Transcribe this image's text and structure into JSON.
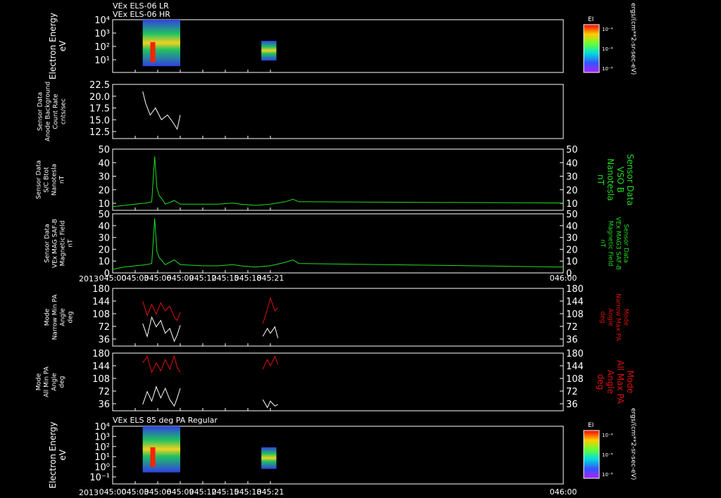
{
  "header": {
    "line1": "VEx ELS-06 LR",
    "line2": "VEx ELS-06 HR",
    "panel7_title": "VEx ELS 85 deg PA Regular",
    "year": "2013"
  },
  "colorbar": {
    "label": "EI",
    "ticks": [
      "10⁻⁴",
      "10⁻⁶",
      "10⁻⁸"
    ],
    "units": "ergs/(cm**2-sr-sec-eV)"
  },
  "colors": {
    "white": "#ffffff",
    "green": "#22dd22",
    "red": "#dd1111",
    "axis": "#ffffff"
  },
  "time_axis": {
    "start": "045:00",
    "end": "046:00",
    "ticks": [
      "045:00",
      "045:03",
      "045:06",
      "045:09",
      "045:12",
      "045:15",
      "045:18",
      "045:21",
      "046:00"
    ]
  },
  "chart_data": [
    {
      "type": "heatmap",
      "name": "panel1",
      "ylabel": [
        "Electron Energy",
        "eV"
      ],
      "yscale": "log",
      "yticks": [
        "10⁴",
        "10³",
        "10²",
        "10¹"
      ],
      "ylim": [
        1,
        10000
      ],
      "blocks": [
        {
          "x_start": "045:04",
          "x_end": "045:09",
          "e_min": 3,
          "e_max": 10000
        },
        {
          "x_start": "045:19.8",
          "x_end": "045:21.8",
          "e_min": 8,
          "e_max": 250
        }
      ],
      "feature": {
        "x": "045:05.3",
        "e_min": 6,
        "e_max": 200
      }
    },
    {
      "type": "line",
      "name": "panel2",
      "ylabel": [
        "Sensor Data",
        "Anode Background",
        "Count Rate",
        "cnts/sec"
      ],
      "ylim": [
        11,
        22.5
      ],
      "yticks": [
        "22.5",
        "20.0",
        "17.5",
        "15.0",
        "12.5"
      ],
      "series": [
        {
          "color": "white",
          "points": [
            [
              "045:04",
              21
            ],
            [
              "045:04.4",
              18.5
            ],
            [
              "045:05",
              16
            ],
            [
              "045:05.7",
              17.5
            ],
            [
              "045:06.5",
              15
            ],
            [
              "045:07.3",
              16
            ],
            [
              "045:08",
              14.5
            ],
            [
              "045:08.6",
              13
            ],
            [
              "045:09",
              16
            ]
          ]
        }
      ]
    },
    {
      "type": "line",
      "name": "panel3",
      "ylabel": [
        "Sensor Data",
        "S/C Btot",
        "Nanotesla",
        "nT"
      ],
      "ylabel_right": [
        "Sensor Data",
        "VSO B",
        "Nanotesla",
        "nT"
      ],
      "ylim": [
        0,
        50
      ],
      "yticks": [
        "50",
        "40",
        "30",
        "20",
        "10"
      ],
      "yticks_right": [
        "50",
        "40",
        "30",
        "20",
        "10"
      ],
      "series": [
        {
          "color": "green",
          "points": [
            [
              "045:00",
              3
            ],
            [
              "045:01.5",
              4
            ],
            [
              "045:03",
              5
            ],
            [
              "045:04.5",
              6
            ],
            [
              "045:05.2",
              7
            ],
            [
              "045:05.6",
              44
            ],
            [
              "045:05.9",
              18
            ],
            [
              "045:06.2",
              12
            ],
            [
              "045:06.6",
              9
            ],
            [
              "045:07",
              5
            ],
            [
              "045:08.2",
              8
            ],
            [
              "045:09",
              5
            ],
            [
              "045:12",
              5
            ],
            [
              "045:14",
              5
            ],
            [
              "045:16",
              6
            ],
            [
              "045:17",
              5
            ],
            [
              "045:19",
              4
            ],
            [
              "045:21",
              5
            ],
            [
              "045:23",
              7
            ],
            [
              "045:24",
              9
            ],
            [
              "045:24.8",
              7
            ],
            [
              "046:00",
              6
            ]
          ]
        }
      ]
    },
    {
      "type": "line",
      "name": "panel4",
      "ylabel": [
        "Sensor Data",
        "VEx MAG SAF-B",
        "Magnetic Field",
        "nT"
      ],
      "ylabel_right": [
        "Sensor Data",
        "VEx MAG3 SAF-B",
        "Magnetic Field",
        "nT"
      ],
      "ylim": [
        0,
        50
      ],
      "yticks": [
        "50",
        "40",
        "30",
        "20",
        "10",
        "0"
      ],
      "yticks_right": [
        "50",
        "40",
        "30",
        "20",
        "10",
        "0"
      ],
      "series": [
        {
          "color": "green",
          "points": [
            [
              "045:00",
              3
            ],
            [
              "045:01.5",
              5
            ],
            [
              "045:03",
              6
            ],
            [
              "045:04.5",
              7
            ],
            [
              "045:05.2",
              8
            ],
            [
              "045:05.6",
              46
            ],
            [
              "045:05.9",
              18
            ],
            [
              "045:06.2",
              13
            ],
            [
              "045:06.6",
              10
            ],
            [
              "045:07",
              7
            ],
            [
              "045:08.2",
              11
            ],
            [
              "045:09",
              7
            ],
            [
              "045:12",
              6
            ],
            [
              "045:14",
              6
            ],
            [
              "045:16",
              7
            ],
            [
              "045:17",
              6
            ],
            [
              "045:19",
              5
            ],
            [
              "045:21",
              6
            ],
            [
              "045:23",
              9
            ],
            [
              "045:24",
              11
            ],
            [
              "045:24.8",
              8
            ],
            [
              "046:00",
              5
            ]
          ]
        }
      ]
    },
    {
      "type": "line",
      "name": "panel5",
      "ylabel": [
        "Mode",
        "Narrow Min PA",
        "Angle",
        "deg"
      ],
      "ylabel_right": [
        "Mode",
        "Narrow Max PA",
        "Angle",
        "deg"
      ],
      "ylim": [
        0,
        180
      ],
      "yticks": [
        "180",
        "144",
        "108",
        "72",
        "36"
      ],
      "yticks_right": [
        "180",
        "144",
        "108",
        "72",
        "36"
      ],
      "series": [
        {
          "color": "red",
          "segments": [
            [
              [
                "045:04",
                140
              ],
              [
                "045:04.6",
                95
              ],
              [
                "045:05.2",
                130
              ],
              [
                "045:05.8",
                100
              ],
              [
                "045:06.4",
                135
              ],
              [
                "045:07",
                110
              ],
              [
                "045:07.6",
                125
              ],
              [
                "045:08.2",
                90
              ],
              [
                "045:08.6",
                80
              ],
              [
                "045:09",
                105
              ]
            ],
            [
              [
                "045:20",
                70
              ],
              [
                "045:20.6",
                115
              ],
              [
                "045:21",
                150
              ],
              [
                "045:21.6",
                110
              ],
              [
                "045:22",
                120
              ]
            ]
          ]
        },
        {
          "color": "white",
          "segments": [
            [
              [
                "045:04",
                70
              ],
              [
                "045:04.6",
                30
              ],
              [
                "045:05.2",
                90
              ],
              [
                "045:05.8",
                60
              ],
              [
                "045:06.4",
                80
              ],
              [
                "045:07",
                40
              ],
              [
                "045:07.6",
                55
              ],
              [
                "045:08.2",
                15
              ],
              [
                "045:08.6",
                35
              ],
              [
                "045:09",
                65
              ]
            ],
            [
              [
                "045:20",
                30
              ],
              [
                "045:20.6",
                55
              ],
              [
                "045:21",
                40
              ],
              [
                "045:21.6",
                60
              ],
              [
                "045:22",
                25
              ]
            ]
          ]
        }
      ]
    },
    {
      "type": "line",
      "name": "panel6",
      "ylabel": [
        "Mode",
        "All Min PA",
        "Angle",
        "deg"
      ],
      "ylabel_right": [
        "Mode",
        "All Max PA",
        "Angle",
        "deg"
      ],
      "ylim": [
        0,
        180
      ],
      "yticks": [
        "180",
        "144",
        "108",
        "72",
        "36"
      ],
      "yticks_right": [
        "180",
        "144",
        "108",
        "72",
        "36"
      ],
      "series": [
        {
          "color": "red",
          "segments": [
            [
              [
                "045:04",
                150
              ],
              [
                "045:04.6",
                170
              ],
              [
                "045:05.2",
                120
              ],
              [
                "045:05.8",
                150
              ],
              [
                "045:06.4",
                125
              ],
              [
                "045:07",
                160
              ],
              [
                "045:07.6",
                130
              ],
              [
                "045:08.2",
                170
              ],
              [
                "045:08.6",
                135
              ],
              [
                "045:09",
                120
              ]
            ],
            [
              [
                "045:20",
                130
              ],
              [
                "045:20.6",
                160
              ],
              [
                "045:21",
                140
              ],
              [
                "045:21.6",
                170
              ],
              [
                "045:22",
                145
              ]
            ]
          ]
        },
        {
          "color": "white",
          "segments": [
            [
              [
                "045:04",
                20
              ],
              [
                "045:04.6",
                60
              ],
              [
                "045:05.2",
                30
              ],
              [
                "045:05.8",
                75
              ],
              [
                "045:06.4",
                40
              ],
              [
                "045:07",
                70
              ],
              [
                "045:07.6",
                35
              ],
              [
                "045:08.2",
                15
              ],
              [
                "045:08.6",
                40
              ],
              [
                "045:09",
                70
              ]
            ],
            [
              [
                "045:20",
                35
              ],
              [
                "045:20.6",
                10
              ],
              [
                "045:21",
                30
              ],
              [
                "045:21.6",
                15
              ],
              [
                "045:22",
                20
              ]
            ]
          ]
        }
      ]
    },
    {
      "type": "heatmap",
      "name": "panel7",
      "ylabel": [
        "Electron Energy",
        "eV"
      ],
      "yscale": "log",
      "yticks": [
        "10⁴",
        "10³",
        "10²",
        "10¹",
        "10⁰",
        "10⁻¹"
      ],
      "ylim": [
        0.1,
        10000
      ],
      "blocks": [
        {
          "x_start": "045:04",
          "x_end": "045:09",
          "e_min": 1,
          "e_max": 10000
        },
        {
          "x_start": "045:19.8",
          "x_end": "045:21.8",
          "e_min": 2,
          "e_max": 150
        }
      ],
      "feature": {
        "x": "045:05.3",
        "e_min": 3,
        "e_max": 150
      }
    }
  ]
}
